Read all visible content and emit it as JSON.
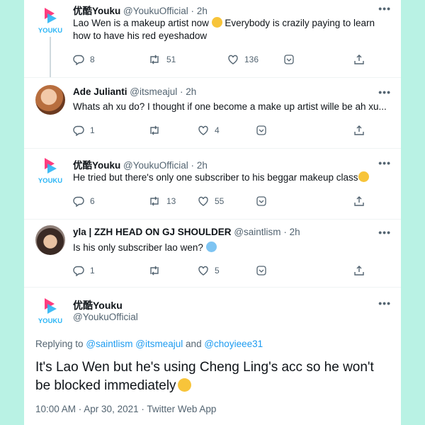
{
  "tweets": [
    {
      "name": "优酷Youku",
      "handle": "@YoukuOfficial",
      "sep": "·",
      "time": "2h",
      "text": "Lao Wen is a makeup artist now",
      "text2": "Everybody is crazily paying to learn how to have his red eyeshadow",
      "replies": "8",
      "retweets": "51",
      "likes": "136"
    },
    {
      "name": "Ade Julianti",
      "handle": "@itsmeajul",
      "sep": "·",
      "time": "2h",
      "text": "Whats ah xu do? I thought if one become a make up artist wille be ah xu...",
      "replies": "1",
      "retweets": "",
      "likes": "4"
    },
    {
      "name": "优酷Youku",
      "handle": "@YoukuOfficial",
      "sep": "·",
      "time": "2h",
      "text": "He tried but there's only one subscriber to his beggar makeup class",
      "replies": "6",
      "retweets": "13",
      "likes": "55"
    },
    {
      "name": "yla | ZZH HEAD ON GJ SHOULDER",
      "handle": "@saintlism",
      "sep": "·",
      "time": "2h",
      "text": "Is his only subscriber lao wen?",
      "replies": "1",
      "retweets": "",
      "likes": "5"
    }
  ],
  "main_tweet": {
    "name": "优酷Youku",
    "handle": "@YoukuOfficial",
    "replying_prefix": "Replying to",
    "mention1": "@saintlism",
    "mention2": "@itsmeajul",
    "and": "and",
    "mention3": "@choyieee31",
    "text": "It's Lao Wen but he's using Cheng Ling's acc so he won't be blocked immediately",
    "meta": "10:00 AM · Apr 30, 2021 · Twitter Web App"
  },
  "logo_text": "YOUKU",
  "dots": "•••",
  "colors": {
    "background": "#b9f2e4",
    "youku_pink": "#ff3d7f",
    "youku_blue": "#2bb5f5",
    "link": "#1d9bf0",
    "secondary": "#536471"
  }
}
